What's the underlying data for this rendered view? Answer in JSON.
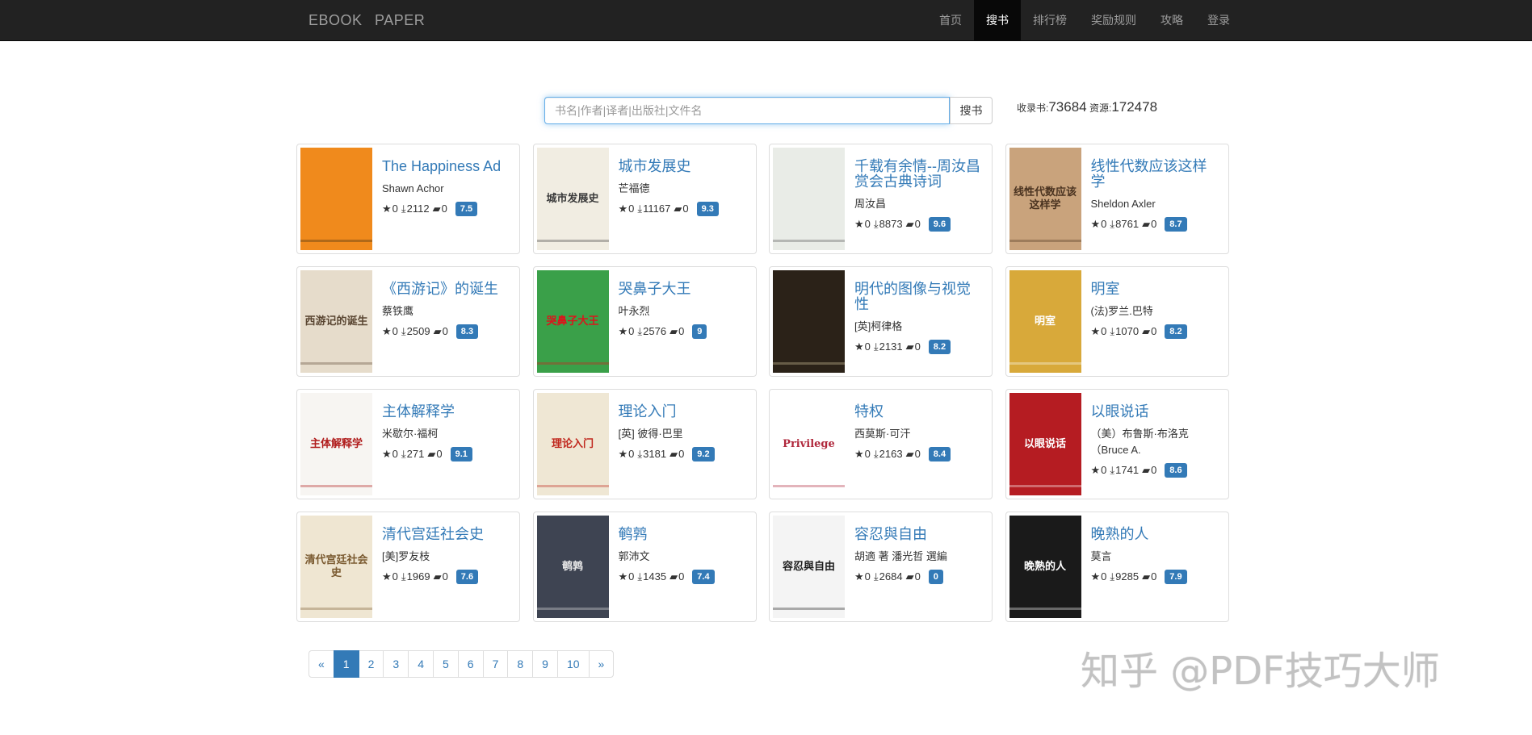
{
  "nav": {
    "brand": "EBOOK   PAPER",
    "items": [
      {
        "label": "首页",
        "active": false
      },
      {
        "label": "搜书",
        "active": true
      },
      {
        "label": "排行榜",
        "active": false
      },
      {
        "label": "奖励规则",
        "active": false
      },
      {
        "label": "攻略",
        "active": false
      },
      {
        "label": "登录",
        "active": false
      }
    ]
  },
  "search": {
    "placeholder": "书名|作者|译者|出版社|文件名",
    "value": "",
    "button_label": "搜书"
  },
  "stats": {
    "books_label": "收录书:",
    "books_count": "73684",
    "resources_label": "资源:",
    "resources_count": "172478"
  },
  "books": [
    {
      "title": "The Happiness Ad",
      "author": "Shawn Achor",
      "stars": "0",
      "downloads": "2112",
      "comments": "0",
      "rating": "7.5",
      "cover_bg": "#f08a1c",
      "cover_fg": "#3a2a10",
      "cover_text": ""
    },
    {
      "title": "城市发展史",
      "author": "芒福德",
      "stars": "0",
      "downloads": "11167",
      "comments": "0",
      "rating": "9.3",
      "cover_bg": "#f1ede2",
      "cover_fg": "#3b3b3b",
      "cover_text": "城市发展史"
    },
    {
      "title": "千载有余情--周汝昌赏会古典诗词",
      "author": "周汝昌",
      "stars": "0",
      "downloads": "8873",
      "comments": "0",
      "rating": "9.6",
      "cover_bg": "#e9ece7",
      "cover_fg": "#555",
      "cover_text": ""
    },
    {
      "title": "线性代数应该这样学",
      "author": "Sheldon Axler",
      "stars": "0",
      "downloads": "8761",
      "comments": "0",
      "rating": "8.7",
      "cover_bg": "#c9a37c",
      "cover_fg": "#4a3320",
      "cover_text": "线性代数应该这样学"
    },
    {
      "title": "《西游记》的诞生",
      "author": "蔡铁鹰",
      "stars": "0",
      "downloads": "2509",
      "comments": "0",
      "rating": "8.3",
      "cover_bg": "#e6dccb",
      "cover_fg": "#5a4632",
      "cover_text": "西游记的诞生"
    },
    {
      "title": "哭鼻子大王",
      "author": "叶永烈",
      "stars": "0",
      "downloads": "2576",
      "comments": "0",
      "rating": "9",
      "cover_bg": "#3aa049",
      "cover_fg": "#d9161c",
      "cover_text": "哭鼻子大王"
    },
    {
      "title": "明代的图像与视觉性",
      "author": "[英]柯律格",
      "stars": "0",
      "downloads": "2131",
      "comments": "0",
      "rating": "8.2",
      "cover_bg": "#2b2218",
      "cover_fg": "#d8c8a0",
      "cover_text": ""
    },
    {
      "title": "明室",
      "author": "(法)罗兰.巴特",
      "stars": "0",
      "downloads": "1070",
      "comments": "0",
      "rating": "8.2",
      "cover_bg": "#d8a93a",
      "cover_fg": "#ffffff",
      "cover_text": "明室"
    },
    {
      "title": "主体解释学",
      "author": "米歇尔·福柯",
      "stars": "0",
      "downloads": "271",
      "comments": "0",
      "rating": "9.1",
      "cover_bg": "#f7f5f2",
      "cover_fg": "#b01c1c",
      "cover_text": "主体解释学"
    },
    {
      "title": "理论入门",
      "author": "[英] 彼得·巴里",
      "stars": "0",
      "downloads": "3181",
      "comments": "0",
      "rating": "9.2",
      "cover_bg": "#efe7d4",
      "cover_fg": "#c0281e",
      "cover_text": "理论入门"
    },
    {
      "title": "特权",
      "author": "西莫斯·可汗",
      "stars": "0",
      "downloads": "2163",
      "comments": "0",
      "rating": "8.4",
      "cover_bg": "#ffffff",
      "cover_fg": "#b0283c",
      "cover_text": "Privilege"
    },
    {
      "title": "以眼说话",
      "author": "（美）布鲁斯·布洛克（Bruce A.",
      "stars": "0",
      "downloads": "1741",
      "comments": "0",
      "rating": "8.6",
      "cover_bg": "#b51c22",
      "cover_fg": "#ffffff",
      "cover_text": "以眼说话"
    },
    {
      "title": "清代宫廷社会史",
      "author": "[美]罗友枝",
      "stars": "0",
      "downloads": "1969",
      "comments": "0",
      "rating": "7.6",
      "cover_bg": "#efe6d2",
      "cover_fg": "#7a5a30",
      "cover_text": "清代宫廷社会史"
    },
    {
      "title": "鹌鹑",
      "author": "郭沛文",
      "stars": "0",
      "downloads": "1435",
      "comments": "0",
      "rating": "7.4",
      "cover_bg": "#3e4452",
      "cover_fg": "#e6e6e6",
      "cover_text": "鹌鹑"
    },
    {
      "title": "容忍與自由",
      "author": "胡適 著 潘光哲 選編",
      "stars": "0",
      "downloads": "2684",
      "comments": "0",
      "rating": "0",
      "cover_bg": "#f4f4f4",
      "cover_fg": "#1c1c1c",
      "cover_text": "容忍與自由"
    },
    {
      "title": "晚熟的人",
      "author": "莫言",
      "stars": "0",
      "downloads": "9285",
      "comments": "0",
      "rating": "7.9",
      "cover_bg": "#1a1a1a",
      "cover_fg": "#ffffff",
      "cover_text": "晚熟的人"
    }
  ],
  "pagination": {
    "prev": "«",
    "pages": [
      "1",
      "2",
      "3",
      "4",
      "5",
      "6",
      "7",
      "8",
      "9",
      "10"
    ],
    "current": "1",
    "next": "»"
  },
  "watermark": "知乎 @PDF技巧大师",
  "colors": {
    "navbar_bg": "#222222",
    "link": "#337ab7",
    "badge": "#337ab7"
  }
}
